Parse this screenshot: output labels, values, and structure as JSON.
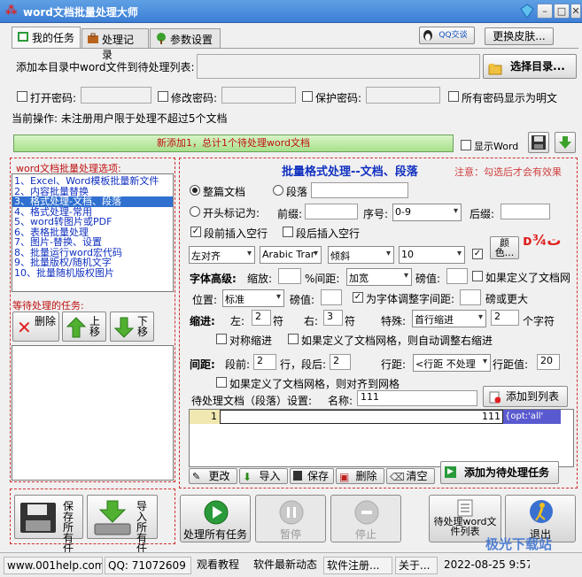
{
  "app": {
    "title": "word文档批量处理大师",
    "logo": "⁂"
  },
  "tabs": [
    {
      "label": "我的任务"
    },
    {
      "label": "处理记录"
    },
    {
      "label": "参数设置"
    }
  ],
  "header": {
    "qq_btn": "QQ交谈",
    "skin_btn": "更换皮肤..."
  },
  "add_dir": {
    "label": "添加本目录中word文件到待处理列表:",
    "value": "",
    "select_btn": "选择目录..."
  },
  "passwords": {
    "open": "打开密码:",
    "modify": "修改密码:",
    "protect": "保护密码:",
    "show_plain": "所有密码显示为明文"
  },
  "current_op": "当前操作: 未注册用户限于处理不超过5个文档",
  "progress": {
    "text": "新添加1，总计1个待处理word文档",
    "show_word": "显示Word"
  },
  "options": {
    "title": "word文档批量处理选项:",
    "items": [
      "1、Excel、Word模板批量新文件",
      "2、内容批量替换",
      "3、格式处理-文档、段落",
      "4、格式处理-常用",
      "5、word转图片或PDF",
      "6、表格批量处理",
      "7、图片-替换、设置",
      "8、批量运行word宏代码",
      "9、批量版权/随机文字",
      "10、批量随机版权图片"
    ],
    "selected_index": 2
  },
  "pending": {
    "title": "等待处理的任务:",
    "delete": "删除",
    "up": "上移",
    "down": "下移"
  },
  "bottom_left": {
    "save_all": "保存所有任务",
    "import_all": "导入所有任务"
  },
  "main": {
    "title": "批量格式处理--文档、段落",
    "note": "注意：勾选后才会有效果",
    "radio_doc": "整篇文档",
    "radio_para": "段落",
    "radio_start": "开头标记为:",
    "prefix": "前缀:",
    "seq": "序号:",
    "seq_value": "0-9",
    "suffix": "后缀:",
    "space_before": "段前插入空行",
    "space_after": "段后插入空行",
    "align": "左对齐",
    "font": "Arabic Trar",
    "style": "倾斜",
    "size": "10",
    "color_btn": "颜色...",
    "sample": "ᴅ¾ت",
    "font_adv": "字体高级:",
    "scale": "缩放:",
    "pct_spacing": "%间距:",
    "spacing_value": "加宽",
    "pound": "磅值:",
    "grid_check": "如果定义了文档网",
    "position": "位置:",
    "position_value": "标准",
    "pound2": "磅值:",
    "kerning": "为字体调整字间距:",
    "pt_or_more": "磅或更大",
    "indent": "缩进:",
    "left": "左:",
    "left_v": "2",
    "char1": "符",
    "right": "右:",
    "right_v": "3",
    "char2": "符",
    "special": "特殊:",
    "special_value": "首行缩进",
    "special_num": "2",
    "chars": "个字符",
    "sym_indent": "对称缩进",
    "grid_indent": "如果定义了文档网格，则自动调整右缩进",
    "spacing": "间距:",
    "before": "段前:",
    "before_v": "2",
    "line_after": "行，段后:",
    "after_v": "2",
    "line_spacing": "行距:",
    "line_spacing_value": "<行距 不处理",
    "line_val": "行距值:",
    "line_val_v": "20",
    "grid_align": "如果定义了文档网格，则对齐到网格",
    "pending_settings": "待处理文档（段落）设置:",
    "name": "名称:",
    "name_value": "111",
    "add_to_list": "添加到列表",
    "row": {
      "num": "1",
      "name": "111",
      "json": "{opt:'all'"
    },
    "btns": {
      "edit": "更改",
      "import": "导入",
      "save": "保存",
      "delete": "删除",
      "clear": "清空"
    },
    "add_task": "添加为待处理任务"
  },
  "actions": {
    "process_all": "处理所有任务",
    "pause": "暂停",
    "stop": "停止",
    "pending_list": "待处理word文件列表",
    "exit": "退出"
  },
  "watermark": "极光下载站",
  "status": {
    "site": "www.001help.com",
    "qq": "QQ: 71072609",
    "tutorial": "观看教程",
    "news": "软件最新动态",
    "register": "软件注册...",
    "about": "关于...",
    "time": "2022-08-25 9:57"
  },
  "colors": {
    "accent": "#3c7fd6",
    "title_blue": "#1030c0",
    "red_dash": "#d03030",
    "progress_green": "#a6e08a"
  }
}
